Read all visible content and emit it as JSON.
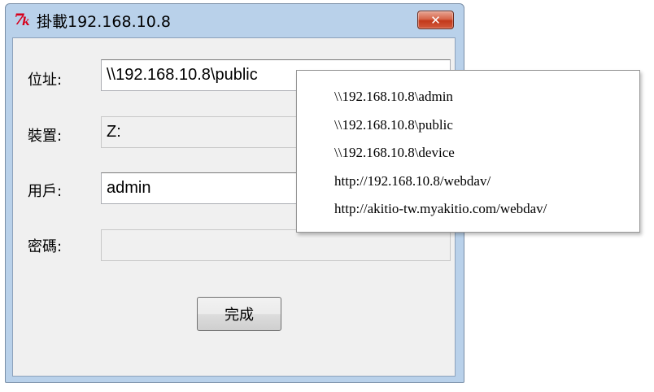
{
  "window": {
    "title": "掛載192.168.10.8",
    "icon_glyphs": [
      "7",
      "k"
    ],
    "close_glyph": "✕"
  },
  "form": {
    "address_label": "位址:",
    "address_value": "\\\\192.168.10.8\\public",
    "device_label": "裝置:",
    "device_value": "Z:",
    "user_label": "用戶:",
    "user_value": "admin",
    "password_label": "密碼:",
    "password_value": "",
    "ok_label": "完成"
  },
  "dropdown": {
    "items": [
      "\\\\192.168.10.8\\admin",
      "\\\\192.168.10.8\\public",
      "\\\\192.168.10.8\\device",
      "http://192.168.10.8/webdav/",
      "http://akitio-tw.myakitio.com/webdav/"
    ]
  },
  "colors": {
    "title_bar": "#b9d1ea",
    "client_bg": "#f0f0f0",
    "close_button": "#c2391b",
    "icon_red": "#d6001c"
  }
}
